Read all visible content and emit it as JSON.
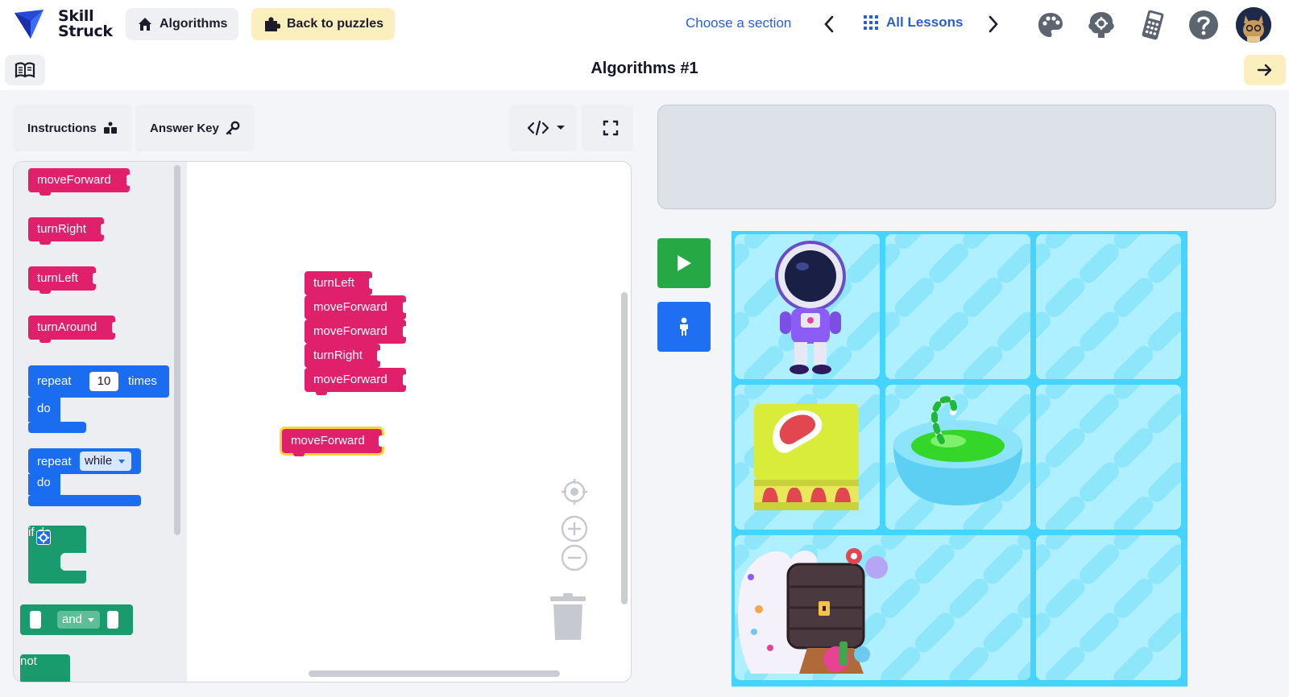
{
  "app": {
    "brand_line1": "Skill",
    "brand_line2": "Struck"
  },
  "nav": {
    "algorithms_label": "Algorithms",
    "back_label": "Back to puzzles",
    "choose_section": "Choose a section",
    "all_lessons": "All Lessons",
    "icons": [
      "palette-icon",
      "brain-icon",
      "calculator-icon",
      "help-icon"
    ]
  },
  "page": {
    "title": "Algorithms #1"
  },
  "toolbar": {
    "instructions_label": "Instructions",
    "answer_key_label": "Answer Key"
  },
  "flyout": {
    "blocks": [
      "moveForward",
      "turnRight",
      "turnLeft",
      "turnAround"
    ],
    "repeat_label": "repeat",
    "repeat_count": "10",
    "times_label": "times",
    "do_label": "do",
    "repeat_while_label": "repeat",
    "while_option": "while",
    "if_label": "if",
    "and_option": "and",
    "not_label": "not"
  },
  "workspace": {
    "stack": [
      "turnLeft",
      "moveForward",
      "moveForward",
      "turnRight",
      "moveForward"
    ],
    "loose_block": "moveForward"
  },
  "colors": {
    "motion_block": "#e0206a",
    "loop_block": "#1a6cf0",
    "logic_block": "#1a9b6e",
    "run": "#26a844",
    "step": "#1f6ff2",
    "accent_blue": "#2a5fd4"
  }
}
